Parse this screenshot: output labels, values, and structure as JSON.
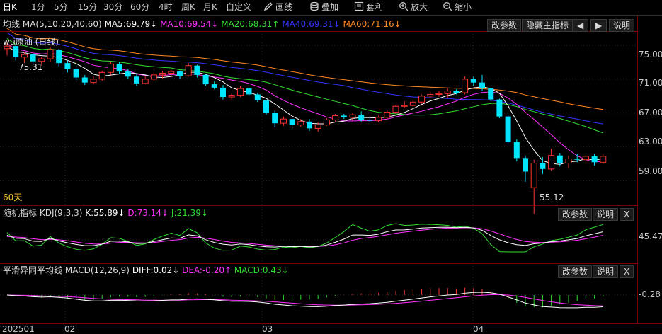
{
  "toolbar": {
    "periods": [
      "日K",
      "1分",
      "5分",
      "15分",
      "30分",
      "60分",
      "4时",
      "周K",
      "月K",
      "自定义"
    ],
    "tools": [
      {
        "icon": "pencil-icon",
        "label": "画线"
      },
      {
        "icon": "layers-icon",
        "label": "叠加"
      },
      {
        "icon": "arbitrage-icon",
        "label": "套利"
      },
      {
        "icon": "zoom-in-icon",
        "label": "放大"
      },
      {
        "icon": "zoom-out-icon",
        "label": "缩小"
      }
    ]
  },
  "main_panel": {
    "ma_label": "均线",
    "ma_name": "MA(5,10,20,40,60)",
    "ma5": "MA5:69.79↓",
    "ma10": "MA10:69.54↓",
    "ma20": "MA20:68.31↑",
    "ma40": "MA40:69.31↓",
    "ma60": "MA60:71.16↓",
    "buttons": {
      "params": "改参数",
      "hide": "隐藏主指标",
      "prev": "◀",
      "next": "▶",
      "help": "说明"
    },
    "title": "wti原油 (日线)",
    "period_label": "60天",
    "high_mark": "75.31",
    "low_mark": "55.12",
    "y_ticks": [
      "75.00",
      "71.00",
      "67.00",
      "63.00",
      "59.00"
    ]
  },
  "kdj_panel": {
    "label": "随机指标",
    "name": "KDJ(9,3,3)",
    "k": "K:55.89↓",
    "d": "D:73.14↓",
    "j": "J:21.39↓",
    "buttons": {
      "params": "改参数",
      "help": "说明",
      "close": "X"
    },
    "y_tick": "45.47"
  },
  "macd_panel": {
    "label": "平滑异同平均线",
    "name": "MACD(12,26,9)",
    "diff": "DIFF:0.02↓",
    "dea": "DEA:-0.20↑",
    "macd": "MACD:0.43↓",
    "buttons": {
      "params": "改参数",
      "help": "说明",
      "close": "X"
    },
    "y_tick": "-0.28"
  },
  "x_axis": [
    "202501",
    "02",
    "03",
    "04"
  ],
  "colors": {
    "up": "#ff3333",
    "down": "#00e5ff",
    "ma5": "#ffffff",
    "ma10": "#ff33ff",
    "ma20": "#33dd33",
    "ma40": "#3333ff",
    "ma60": "#ff8822",
    "border": "#7a0000"
  },
  "chart_data": {
    "type": "candlestick",
    "candles": [
      [
        74.6,
        75.3,
        73.8,
        74.9
      ],
      [
        74.9,
        75.1,
        73.2,
        73.6
      ],
      [
        73.6,
        74.2,
        72.9,
        73.9
      ],
      [
        73.9,
        74.0,
        72.8,
        73.1
      ],
      [
        73.1,
        73.6,
        72.6,
        73.4
      ],
      [
        73.4,
        74.8,
        73.0,
        74.5
      ],
      [
        74.5,
        74.6,
        72.5,
        72.9
      ],
      [
        72.9,
        73.2,
        71.8,
        72.2
      ],
      [
        72.2,
        72.8,
        70.9,
        71.2
      ],
      [
        71.2,
        71.5,
        70.3,
        70.6
      ],
      [
        70.6,
        71.3,
        70.4,
        71.0
      ],
      [
        71.0,
        72.0,
        70.8,
        71.8
      ],
      [
        71.8,
        73.0,
        71.5,
        72.8
      ],
      [
        72.8,
        73.0,
        71.6,
        71.9
      ],
      [
        71.9,
        72.2,
        71.0,
        71.3
      ],
      [
        71.3,
        71.6,
        70.2,
        70.5
      ],
      [
        70.5,
        71.3,
        70.4,
        71.0
      ],
      [
        71.0,
        71.8,
        70.8,
        71.5
      ],
      [
        71.5,
        72.0,
        71.1,
        71.7
      ],
      [
        71.7,
        72.1,
        71.2,
        71.9
      ],
      [
        71.9,
        72.0,
        71.0,
        71.4
      ],
      [
        71.4,
        72.9,
        71.3,
        72.6
      ],
      [
        72.6,
        72.7,
        71.2,
        71.5
      ],
      [
        71.5,
        71.6,
        70.2,
        70.4
      ],
      [
        70.4,
        70.8,
        69.8,
        70.0
      ],
      [
        70.0,
        70.3,
        68.6,
        68.9
      ],
      [
        68.9,
        69.3,
        68.6,
        69.1
      ],
      [
        69.1,
        70.2,
        68.9,
        69.9
      ],
      [
        69.9,
        70.1,
        69.0,
        69.2
      ],
      [
        69.2,
        69.4,
        68.3,
        68.5
      ],
      [
        68.5,
        68.6,
        66.8,
        67.0
      ],
      [
        67.0,
        67.3,
        65.3,
        65.8
      ],
      [
        65.8,
        66.6,
        65.5,
        66.3
      ],
      [
        66.3,
        66.5,
        65.2,
        65.6
      ],
      [
        65.6,
        66.3,
        65.4,
        66.0
      ],
      [
        66.0,
        66.3,
        64.9,
        65.2
      ],
      [
        65.2,
        65.9,
        64.8,
        65.6
      ],
      [
        65.6,
        66.4,
        65.5,
        66.2
      ],
      [
        66.2,
        66.9,
        66.0,
        66.7
      ],
      [
        66.7,
        66.9,
        66.3,
        66.5
      ],
      [
        66.5,
        67.0,
        66.1,
        66.8
      ],
      [
        66.8,
        67.2,
        66.0,
        66.2
      ],
      [
        66.2,
        66.5,
        65.9,
        66.1
      ],
      [
        66.1,
        66.7,
        65.9,
        66.5
      ],
      [
        66.5,
        67.3,
        66.3,
        67.1
      ],
      [
        67.1,
        68.0,
        66.9,
        67.8
      ],
      [
        67.8,
        68.4,
        67.6,
        67.9
      ],
      [
        67.9,
        68.6,
        67.7,
        68.3
      ],
      [
        68.3,
        69.2,
        68.1,
        69.0
      ],
      [
        69.0,
        69.5,
        68.8,
        69.2
      ],
      [
        69.2,
        69.6,
        68.9,
        69.3
      ],
      [
        69.3,
        70.0,
        68.8,
        69.6
      ],
      [
        69.6,
        69.8,
        69.2,
        69.4
      ],
      [
        69.4,
        71.3,
        69.2,
        71.0
      ],
      [
        71.0,
        71.3,
        70.2,
        70.6
      ],
      [
        70.6,
        71.5,
        69.6,
        69.9
      ],
      [
        69.9,
        70.0,
        68.4,
        68.6
      ],
      [
        68.6,
        68.7,
        66.4,
        66.6
      ],
      [
        66.6,
        66.8,
        63.3,
        63.6
      ],
      [
        63.6,
        63.9,
        61.3,
        61.7
      ],
      [
        61.7,
        62.0,
        58.9,
        60.1
      ],
      [
        58.2,
        61.5,
        55.1,
        61.1
      ],
      [
        61.1,
        61.8,
        59.8,
        60.4
      ],
      [
        60.4,
        62.8,
        60.2,
        62.0
      ],
      [
        62.0,
        62.3,
        60.7,
        61.1
      ],
      [
        61.1,
        62.0,
        60.5,
        61.6
      ],
      [
        61.6,
        62.2,
        61.2,
        61.5
      ],
      [
        61.5,
        62.1,
        61.1,
        61.9
      ],
      [
        61.9,
        62.2,
        60.8,
        61.2
      ],
      [
        61.2,
        62.1,
        61.0,
        61.9
      ]
    ],
    "ylim": [
      56.3,
      76.5
    ]
  }
}
